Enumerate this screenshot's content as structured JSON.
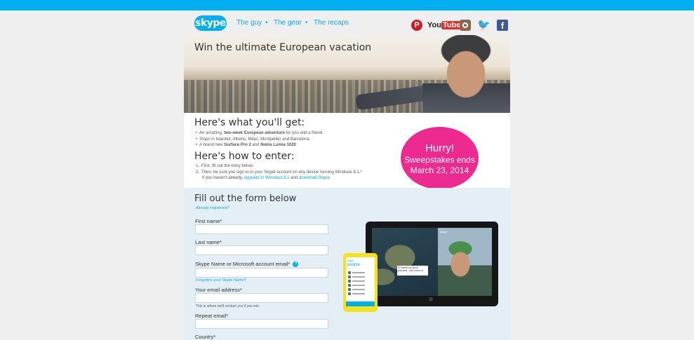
{
  "header": {
    "logo_text": "skype",
    "nav": [
      "The guy",
      "The gear",
      "The recaps"
    ],
    "nav_separator": "•",
    "social": {
      "pinterest_glyph": "P",
      "youtube_you": "You",
      "youtube_tube": "Tube",
      "twitter_glyph": "🐦",
      "facebook_glyph": "f"
    }
  },
  "banner": {
    "title": "Win the ultimate European vacation"
  },
  "get_section": {
    "heading": "Here's what you'll get:",
    "bullet1_pre": "An amazing, ",
    "bullet1_bold": "two-week European adventure",
    "bullet1_post": " for you and a friend",
    "bullet2": "Stops in Istanbul, Athens, Milan, Montpellier and Barcelona",
    "bullet3_pre": "A brand new ",
    "bullet3_bold1": "Surface Pro 2",
    "bullet3_mid": " and ",
    "bullet3_bold2": "Nokia Lumia 1020"
  },
  "how_section": {
    "heading": "Here's how to enter:",
    "step1_num": "1.",
    "step1": "First, fill out the entry below.",
    "step2_num": "2.",
    "step2": "Then, be sure you sign in to your Skype account on any device running Windows 8.1.*",
    "step2b_pre": "If you haven't already, ",
    "step2b_link1": "upgrade to Windows 8.1",
    "step2b_mid": " and ",
    "step2b_link2": "download Skype",
    "step2b_post": "."
  },
  "badge": {
    "line1": "Hurry!",
    "line2": "Sweepstakes ends",
    "line3": "March 23, 2014",
    "color": "#ec2a8f"
  },
  "form": {
    "heading": "Fill out the form below",
    "already_registered": "Already registered?",
    "first_name_label": "First name*",
    "last_name_label": "Last name*",
    "skype_name_label": "Skype Name or Microsoft account email*",
    "info_glyph": "?",
    "forgotten_link": "Forgotten your Skype Name?",
    "email_label": "Your email address*",
    "email_note": "This is where we'll contact you if you win.",
    "repeat_email_label": "Repeat email*",
    "country_label": "Country*"
  },
  "devices": {
    "tablet_app_label": "skype",
    "tablet_tag_line1": "37 check-ins since",
    "tablet_tag_line2": "previous · last check-in",
    "windows_glyph": "⊞",
    "phone_app_label": "skype",
    "phone_heading": "people"
  },
  "colors": {
    "accent": "#00aff0",
    "form_bg": "#e4eff5"
  }
}
